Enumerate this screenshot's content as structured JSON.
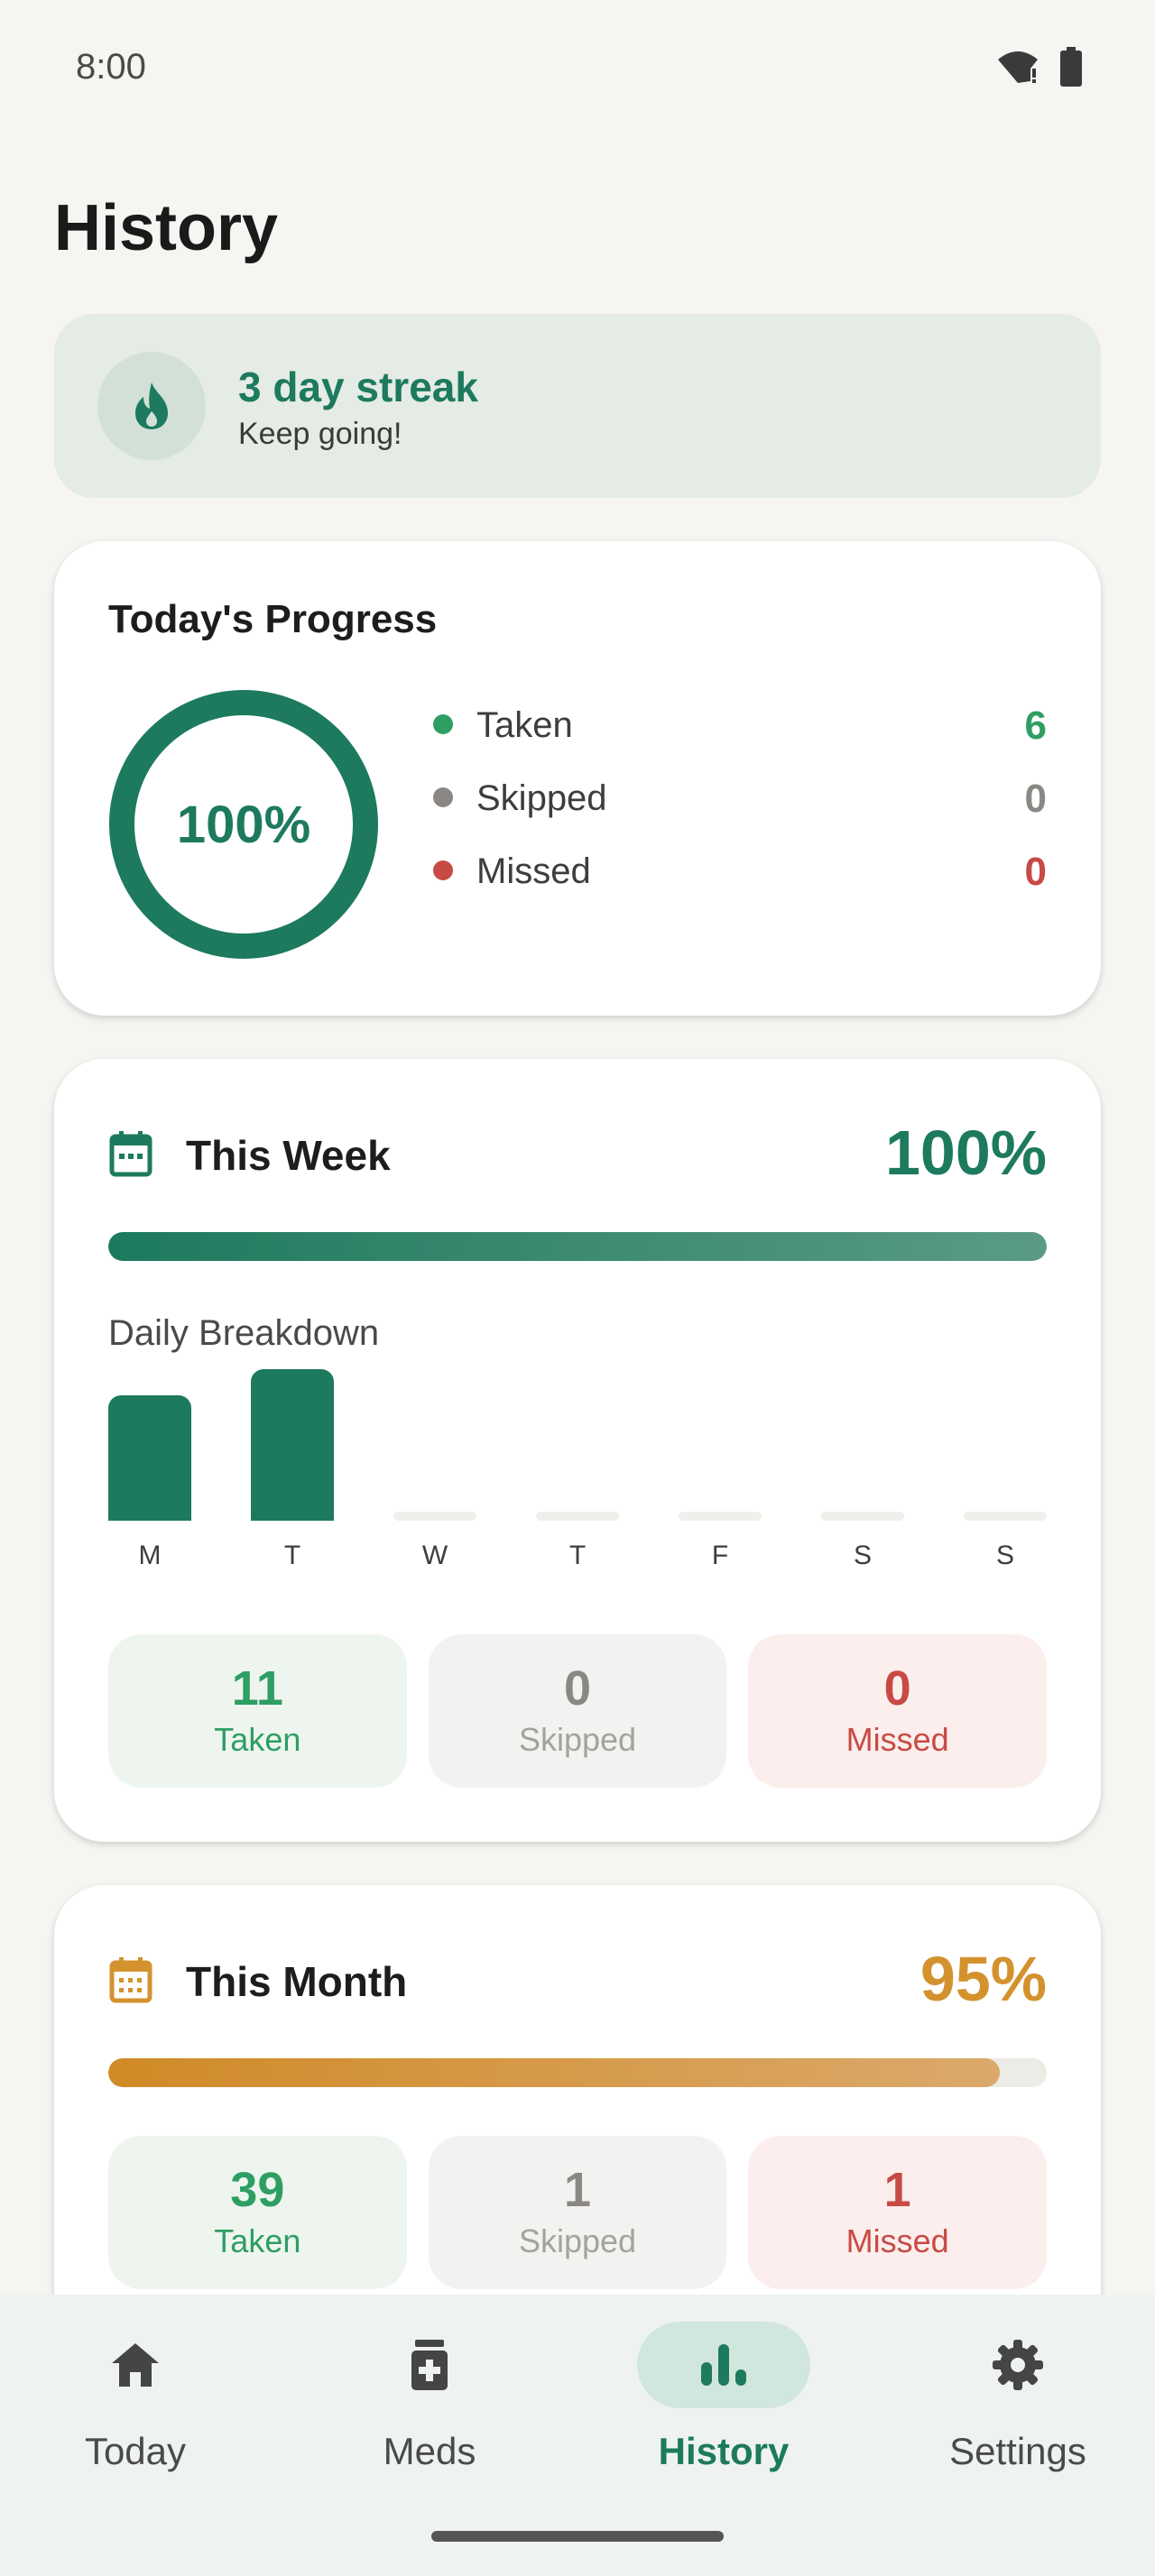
{
  "status": {
    "time": "8:00"
  },
  "page": {
    "title": "History"
  },
  "streak": {
    "title": "3 day streak",
    "subtitle": "Keep going!"
  },
  "today": {
    "title": "Today's Progress",
    "percent_label": "100%",
    "percent": 100,
    "legend": [
      {
        "label": "Taken",
        "value": "6",
        "color": "#2e9e63"
      },
      {
        "label": "Skipped",
        "value": "0",
        "color": "#8b8884"
      },
      {
        "label": "Missed",
        "value": "0",
        "color": "#c84a44"
      }
    ]
  },
  "week": {
    "title": "This Week",
    "percent_label": "100%",
    "percent": 100,
    "breakdown_label": "Daily Breakdown",
    "days": [
      {
        "label": "M",
        "level": 0.83
      },
      {
        "label": "T",
        "level": 1.0
      },
      {
        "label": "W",
        "level": 0
      },
      {
        "label": "T",
        "level": 0
      },
      {
        "label": "F",
        "level": 0
      },
      {
        "label": "S",
        "level": 0
      },
      {
        "label": "S",
        "level": 0
      }
    ],
    "stats": {
      "taken": {
        "value": "11",
        "label": "Taken"
      },
      "skipped": {
        "value": "0",
        "label": "Skipped"
      },
      "missed": {
        "value": "0",
        "label": "Missed"
      }
    }
  },
  "month": {
    "title": "This Month",
    "percent_label": "95%",
    "percent": 95,
    "stats": {
      "taken": {
        "value": "39",
        "label": "Taken"
      },
      "skipped": {
        "value": "1",
        "label": "Skipped"
      },
      "missed": {
        "value": "1",
        "label": "Missed"
      }
    }
  },
  "nav": {
    "items": [
      {
        "label": "Today",
        "icon": "home-icon"
      },
      {
        "label": "Meds",
        "icon": "medicine-icon"
      },
      {
        "label": "History",
        "icon": "bar-chart-icon",
        "active": true
      },
      {
        "label": "Settings",
        "icon": "gear-icon"
      }
    ]
  },
  "colors": {
    "accent": "#1d7a5e",
    "month_accent": "#d4922e",
    "background": "#f6f5f2"
  }
}
